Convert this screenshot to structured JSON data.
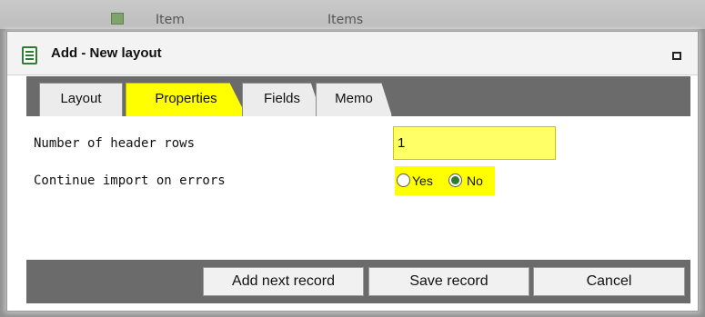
{
  "background": {
    "items": [
      "Item",
      "Items"
    ],
    "icon": "spreadsheet-icon"
  },
  "dialog": {
    "title": "Add - New layout",
    "title_icon": "form-icon",
    "maximize_icon": "maximize-icon"
  },
  "tabs": [
    {
      "label": "Layout",
      "active": false
    },
    {
      "label": "Properties",
      "active": true
    },
    {
      "label": "Fields",
      "active": false
    },
    {
      "label": "Memo",
      "active": false
    }
  ],
  "form": {
    "header_rows_label": "Number of header rows",
    "header_rows_value": "1",
    "continue_label": "Continue import on errors",
    "yes_label": "Yes",
    "no_label": "No",
    "selected": "No"
  },
  "buttons": {
    "add_next": "Add next record",
    "save": "Save record",
    "cancel": "Cancel"
  },
  "colors": {
    "highlight": "#ffff00",
    "bar": "#6b6b6b",
    "accent": "#2e7d32"
  }
}
